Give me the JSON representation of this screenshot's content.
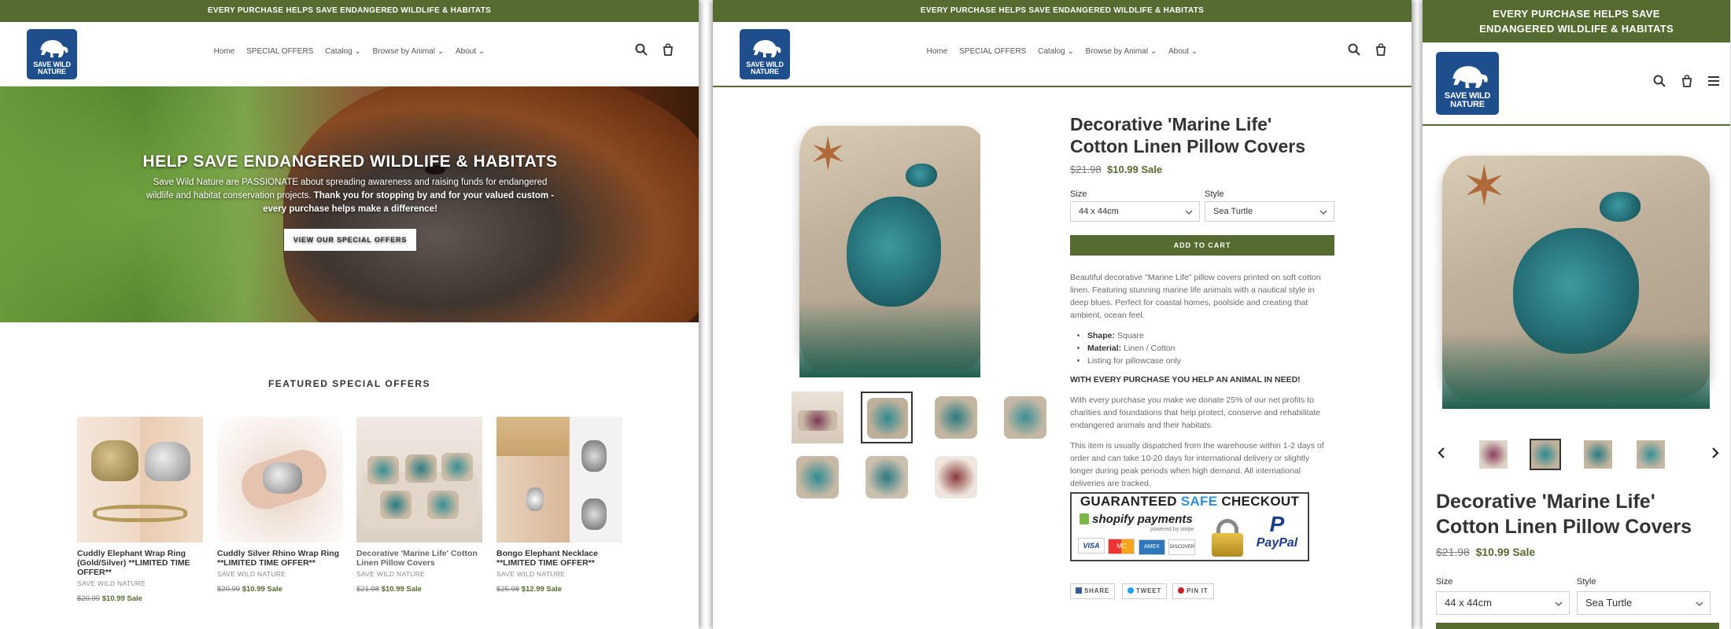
{
  "announcement": "EVERY PURCHASE HELPS SAVE ENDANGERED WILDLIFE & HABITATS",
  "logo": {
    "line1": "SAVE WILD",
    "line2": "NATURE"
  },
  "nav": [
    "Home",
    "SPECIAL OFFERS",
    "Catalog",
    "Browse by Animal",
    "About"
  ],
  "hero": {
    "title": "HELP SAVE ENDANGERED WILDLIFE & HABITATS",
    "text_plain": "Save Wild Nature are PASSIONATE about spreading awareness and raising funds for endangered wildlife and habitat conservation projects.",
    "text_bold": "Thank you for stopping by and for your valued custom - every purchase helps make a difference!",
    "button": "VIEW OUR SPECIAL OFFERS"
  },
  "featured_title": "FEATURED SPECIAL OFFERS",
  "products": [
    {
      "name": "Cuddly Elephant Wrap Ring (Gold/Silver) **LIMITED TIME OFFER**",
      "vendor": "SAVE WILD NATURE",
      "old_price": "$20.99",
      "price": "$10.99",
      "sale": "Sale"
    },
    {
      "name": "Cuddly Silver Rhino Wrap Ring **LIMITED TIME OFFER**",
      "vendor": "SAVE WILD NATURE",
      "old_price": "$20.99",
      "price": "$10.99",
      "sale": "Sale"
    },
    {
      "name": "Decorative 'Marine Life' Cotton Linen Pillow Covers",
      "vendor": "SAVE WILD NATURE",
      "old_price": "$21.98",
      "price": "$10.99",
      "sale": "Sale"
    },
    {
      "name": "Bongo Elephant Necklace **LIMITED TIME OFFER**",
      "vendor": "SAVE WILD NATURE",
      "old_price": "$25.98",
      "price": "$12.99",
      "sale": "Sale"
    }
  ],
  "product_page": {
    "title": "Decorative 'Marine Life' Cotton Linen Pillow Covers",
    "old_price": "$21.98",
    "price": "$10.99",
    "sale": "Sale",
    "size_label": "Size",
    "size_value": "44 x 44cm",
    "style_label": "Style",
    "style_value": "Sea Turtle",
    "add_to_cart": "ADD TO CART",
    "description": "Beautiful decorative \"Marine Life\" pillow covers printed on soft cotton linen. Featuring stunning marine life animals with a nautical style in deep blues. Perfect for coastal homes, poolside and creating that ambient, ocean feel.",
    "bullets": [
      {
        "key": "Shape:",
        "val": "Square"
      },
      {
        "key": "Material:",
        "val": "Linen / Cotton"
      },
      {
        "key": "",
        "val": "Listing for pillowcase only"
      }
    ],
    "mission": "WITH EVERY PURCHASE YOU HELP AN ANIMAL IN NEED!",
    "donation": "With every purchase you make we donate 25% of our net profits to charities and foundations that help protect, conserve and rehabilitate endangered animals and their habitats.",
    "shipping": "This item is usually dispatched from the warehouse within 1-2 days of order and can take 10-20 days for international delivery or slightly longer during peak periods when high demand. All international deliveries are tracked.",
    "badge": {
      "title_a": "GUARANTEED",
      "title_b": "SAFE",
      "title_c": "CHECKOUT",
      "shopify": "shopify payments",
      "stripe_small": "powered by stripe",
      "cards": [
        "VISA",
        "MC",
        "AMEX",
        "DISCOVER"
      ],
      "paypal": "PayPal"
    },
    "share": [
      "SHARE",
      "TWEET",
      "PIN IT"
    ]
  },
  "colors": {
    "brand": "#556b2f",
    "logo_bg": "#1e4f8c",
    "sale": "#556b2f"
  }
}
